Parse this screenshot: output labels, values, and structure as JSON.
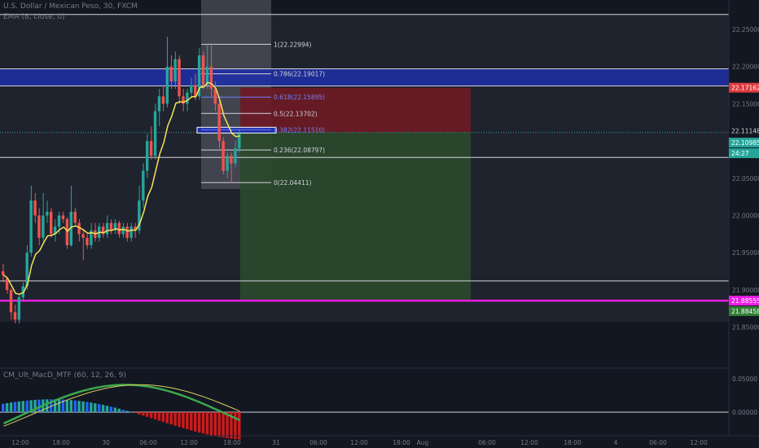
{
  "header": {
    "symbol_title": "U.S. Dollar / Mexican Peso, 30, FXCM",
    "ema_label": "EMA (8, close, 0)"
  },
  "indicator": {
    "label": "CM_Ult_MacD_MTF (60, 12, 26, 9)"
  },
  "colors": {
    "background": "#131722",
    "up_candle": "#26a69a",
    "down_candle": "#ef5350",
    "ema_line": "#f5e35c",
    "magenta_line": "#e91ee5",
    "blue_zone": "#1e2ea8",
    "stop_zone": "#6e1a24",
    "target_zone": "#2a4a2c",
    "axis_text": "#787b86",
    "macd_green": "#3aa84a",
    "macd_red": "#cf1a1a",
    "macd_signal": "#d8d060"
  },
  "price_axis": {
    "ticks": [
      "22.25000",
      "22.20000",
      "22.15000",
      "22.10000",
      "22.05000",
      "22.00000",
      "21.95000",
      "21.90000",
      "21.85000"
    ],
    "badges": {
      "stop_price": "22.17162",
      "current_1": "22.11148",
      "current_2": "22.10985",
      "countdown": "24:27",
      "magenta_price": "21.88555",
      "target_price": "21.88458"
    }
  },
  "macd_axis": {
    "ticks": [
      "0.05000",
      "0.00000"
    ]
  },
  "time_axis": {
    "ticks": [
      "12:00",
      "18:00",
      "30",
      "06:00",
      "12:00",
      "18:00",
      "31",
      "06:00",
      "12:00",
      "18:00",
      "Aug",
      "06:00",
      "12:00",
      "18:00",
      "4",
      "06:00",
      "12:00"
    ]
  },
  "fibonacci": {
    "levels": [
      {
        "ratio": "1",
        "price": 22.22994,
        "label": "1(22.22994)"
      },
      {
        "ratio": "0.786",
        "price": 22.19017,
        "label": "0.786(22.19017)"
      },
      {
        "ratio": "0.618",
        "price": 22.15895,
        "label": "0.618(22.15895)"
      },
      {
        "ratio": "0.5",
        "price": 22.13702,
        "label": "0.5(22.13702)"
      },
      {
        "ratio": "0.382",
        "price": 22.1151,
        "label": "0.382(22.11510)"
      },
      {
        "ratio": "0.236",
        "price": 22.08797,
        "label": "0.236(22.08797)"
      },
      {
        "ratio": "0",
        "price": 22.04411,
        "label": "0(22.04411)"
      }
    ]
  },
  "levels": {
    "horizontal_lines": [
      22.27,
      22.078,
      21.912
    ],
    "magenta_line": 21.88555,
    "blue_zone_top": 22.197,
    "blue_zone_bottom": 22.174,
    "current_price": 22.11148,
    "stop_price": 22.17162,
    "target_price": 21.88458
  },
  "chart_data": {
    "type": "candlestick",
    "candles": [
      [
        21.925,
        21.92,
        21.91,
        21.935
      ],
      [
        21.915,
        21.9,
        21.895,
        21.918
      ],
      [
        21.9,
        21.87,
        21.86,
        21.902
      ],
      [
        21.87,
        21.86,
        21.855,
        21.88
      ],
      [
        21.86,
        21.89,
        21.855,
        21.895
      ],
      [
        21.89,
        21.905,
        21.885,
        21.91
      ],
      [
        21.905,
        21.95,
        21.9,
        21.96
      ],
      [
        21.95,
        22.02,
        21.945,
        22.04
      ],
      [
        22.02,
        22.0,
        21.99,
        22.03
      ],
      [
        22.0,
        21.97,
        21.96,
        22.01
      ],
      [
        21.97,
        22.0,
        21.965,
        22.03
      ],
      [
        22.0,
        22.005,
        21.99,
        22.02
      ],
      [
        22.005,
        21.975,
        21.97,
        22.01
      ],
      [
        21.975,
        21.985,
        21.965,
        21.995
      ],
      [
        21.985,
        22.0,
        21.975,
        22.005
      ],
      [
        22.0,
        21.995,
        21.99,
        22.005
      ],
      [
        21.995,
        21.96,
        21.955,
        21.998
      ],
      [
        21.96,
        22.005,
        21.958,
        22.04
      ],
      [
        22.005,
        21.99,
        21.985,
        22.01
      ],
      [
        21.99,
        21.975,
        21.965,
        21.995
      ],
      [
        21.975,
        21.97,
        21.94,
        21.98
      ],
      [
        21.97,
        21.96,
        21.955,
        21.975
      ],
      [
        21.96,
        21.98,
        21.955,
        21.99
      ],
      [
        21.98,
        21.97,
        21.965,
        21.99
      ],
      [
        21.97,
        21.985,
        21.965,
        21.99
      ],
      [
        21.985,
        21.975,
        21.97,
        21.99
      ],
      [
        21.975,
        21.99,
        21.97,
        22.0
      ],
      [
        21.99,
        21.98,
        21.975,
        21.995
      ],
      [
        21.98,
        21.99,
        21.975,
        21.995
      ],
      [
        21.99,
        21.975,
        21.97,
        21.993
      ],
      [
        21.975,
        21.985,
        21.97,
        21.99
      ],
      [
        21.985,
        21.97,
        21.965,
        21.99
      ],
      [
        21.97,
        21.985,
        21.965,
        21.99
      ],
      [
        21.985,
        21.98,
        21.97,
        21.99
      ],
      [
        21.98,
        22.02,
        21.975,
        22.04
      ],
      [
        22.02,
        22.06,
        22.01,
        22.07
      ],
      [
        22.06,
        22.1,
        22.05,
        22.11
      ],
      [
        22.1,
        22.08,
        22.075,
        22.12
      ],
      [
        22.08,
        22.14,
        22.075,
        22.15
      ],
      [
        22.14,
        22.16,
        22.12,
        22.17
      ],
      [
        22.16,
        22.15,
        22.14,
        22.175
      ],
      [
        22.15,
        22.2,
        22.145,
        22.24
      ],
      [
        22.2,
        22.18,
        22.17,
        22.215
      ],
      [
        22.18,
        22.21,
        22.17,
        22.22
      ],
      [
        22.21,
        22.16,
        22.15,
        22.215
      ],
      [
        22.16,
        22.15,
        22.14,
        22.17
      ],
      [
        22.15,
        22.165,
        22.14,
        22.17
      ],
      [
        22.165,
        22.175,
        22.16,
        22.185
      ],
      [
        22.175,
        22.16,
        22.155,
        22.19
      ],
      [
        22.16,
        22.215,
        22.155,
        22.225
      ],
      [
        22.215,
        22.175,
        22.17,
        22.22
      ],
      [
        22.175,
        22.2,
        22.17,
        22.23
      ],
      [
        22.2,
        22.17,
        22.16,
        22.23
      ],
      [
        22.17,
        22.15,
        22.14,
        22.18
      ],
      [
        22.15,
        22.1,
        22.09,
        22.155
      ],
      [
        22.1,
        22.06,
        22.055,
        22.105
      ],
      [
        22.06,
        22.08,
        22.05,
        22.085
      ],
      [
        22.08,
        22.07,
        22.044,
        22.085
      ],
      [
        22.07,
        22.09,
        22.065,
        22.1
      ],
      [
        22.09,
        22.11,
        22.085,
        22.115
      ]
    ]
  }
}
